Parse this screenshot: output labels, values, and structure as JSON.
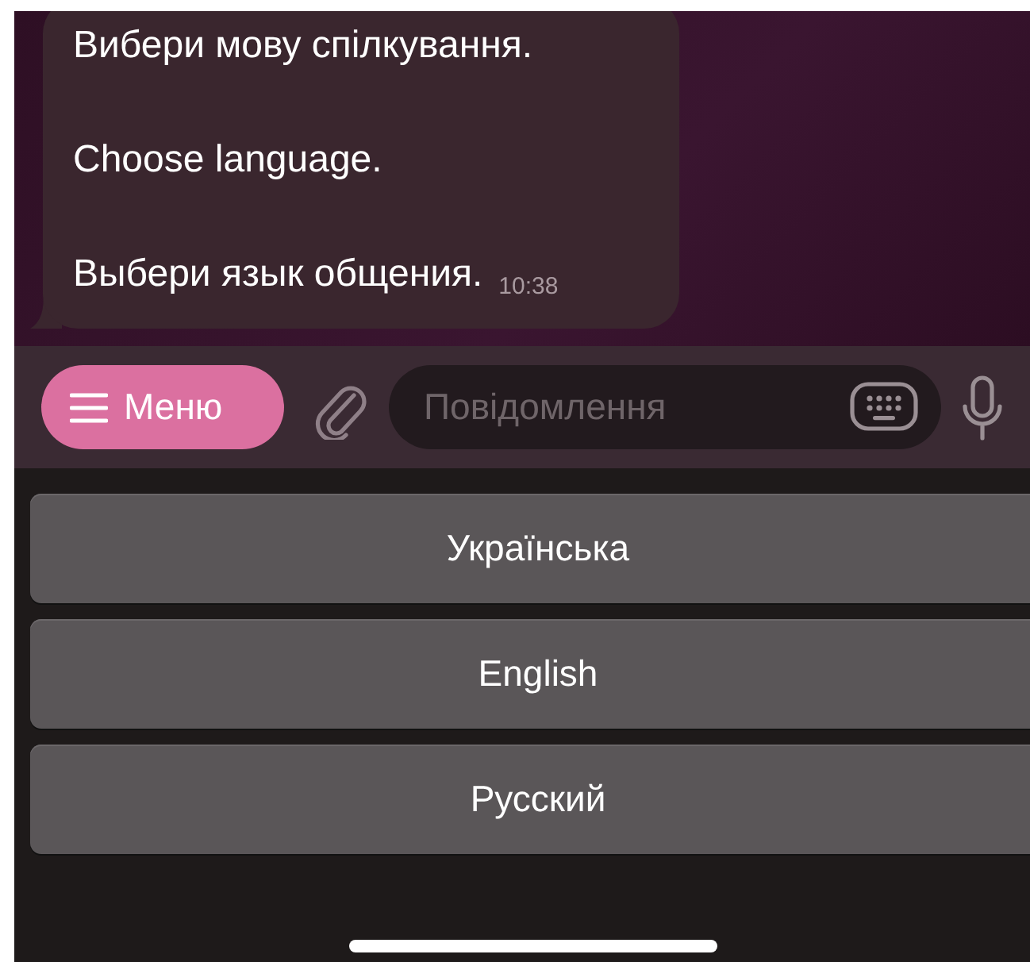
{
  "message": {
    "lines": [
      "Вибери мову спілкування.",
      "Choose language.",
      "Выбери язык общения."
    ],
    "time": "10:38"
  },
  "composer": {
    "menu_label": "Меню",
    "placeholder": "Повідомлення"
  },
  "reply_keyboard": [
    {
      "label": "Українська"
    },
    {
      "label": "English"
    },
    {
      "label": "Русский"
    }
  ]
}
